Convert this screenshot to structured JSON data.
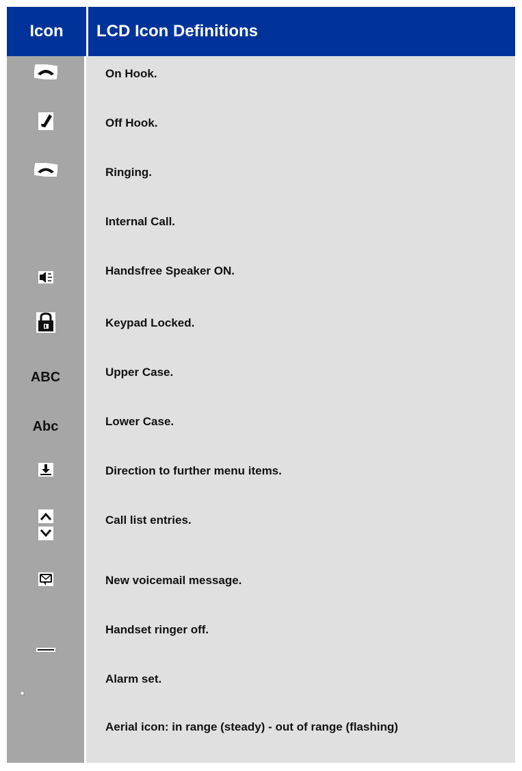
{
  "header": {
    "icon_col": "Icon",
    "def_col": "LCD Icon Definitions"
  },
  "rows": [
    {
      "icon": "handset-on-hook-icon",
      "definition": "On Hook."
    },
    {
      "icon": "handset-off-hook-icon",
      "definition": "Off Hook."
    },
    {
      "icon": "handset-ringing-icon",
      "definition": "Ringing."
    },
    {
      "icon": "",
      "definition": "Internal Call."
    },
    {
      "icon": "speaker-icon",
      "definition": "Handsfree Speaker ON."
    },
    {
      "icon": "lock-icon",
      "definition": "Keypad Locked."
    },
    {
      "icon_text": "ABC",
      "definition": "Upper Case."
    },
    {
      "icon_text": "Abc",
      "definition": "Lower Case."
    },
    {
      "icon": "menu-down-icon",
      "definition": "Direction to further menu items."
    },
    {
      "icon": "chevron-up-down-icon",
      "definition": "Call list entries."
    },
    {
      "icon": "envelope-icon",
      "definition": "New voicemail message."
    },
    {
      "icon": "ringer-off-icon",
      "definition": "Handset ringer off."
    },
    {
      "icon": "alarm-icon",
      "definition": "Alarm set."
    },
    {
      "icon": "",
      "definition": "Aerial icon: in range (steady) - out of range (flashing)"
    }
  ],
  "colors": {
    "header_bg": "#003399",
    "icon_col_bg": "#a6a6a6",
    "def_col_bg": "#e0e0e0"
  }
}
